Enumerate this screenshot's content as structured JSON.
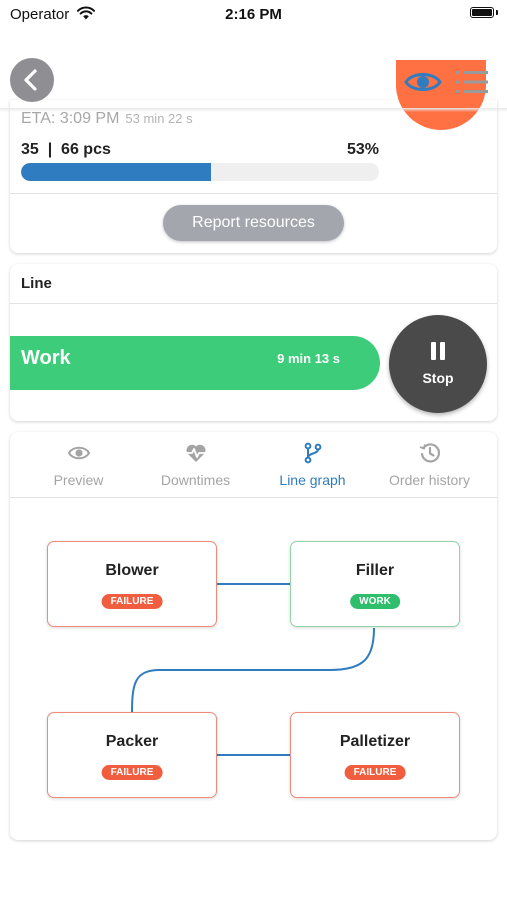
{
  "status_bar": {
    "carrier": "Operator",
    "time": "2:16 PM"
  },
  "nav": {
    "back_icon": "chevron-left-icon",
    "view_icon": "eye-icon",
    "menu_icon": "list-icon"
  },
  "order": {
    "eta": "ETA: 3:09 PM",
    "eta_remaining": "53 min 22 s",
    "pieces": "35  |  66 pcs",
    "percent": "53%",
    "progress_fraction": 0.53,
    "report_button": "Report resources",
    "accent_color": "#ff7043"
  },
  "line": {
    "title": "Line",
    "state": "Work",
    "state_duration": "9 min 13 s",
    "state_color": "#3dcc79",
    "stop_button": "Stop"
  },
  "tabs": [
    {
      "label": "Preview",
      "icon": "eye-icon",
      "active": false
    },
    {
      "label": "Downtimes",
      "icon": "heart-pulse-icon",
      "active": false
    },
    {
      "label": "Line graph",
      "icon": "branch-icon",
      "active": true
    },
    {
      "label": "Order history",
      "icon": "history-icon",
      "active": false
    }
  ],
  "graph": {
    "nodes": [
      {
        "name": "Blower",
        "status": "FAILURE"
      },
      {
        "name": "Filler",
        "status": "WORK"
      },
      {
        "name": "Packer",
        "status": "FAILURE"
      },
      {
        "name": "Palletizer",
        "status": "FAILURE"
      }
    ],
    "colors": {
      "failure": "#f05d3f",
      "work": "#2fbe6b",
      "connector": "#2f7cc1"
    }
  }
}
